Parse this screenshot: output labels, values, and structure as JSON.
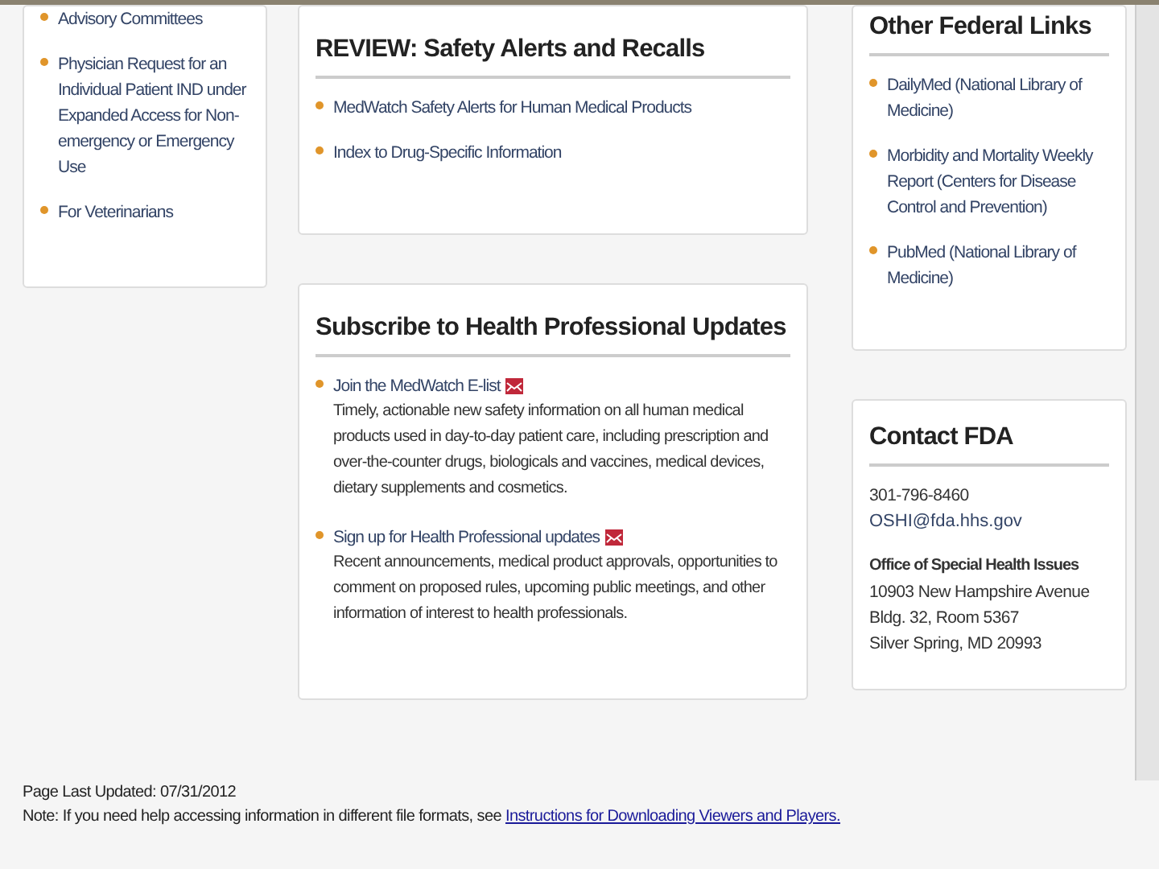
{
  "left_links": [
    "Advisory Committees",
    "Physician Request for an Individual Patient IND under Expanded Access for Non-emergency or Emergency Use",
    "For Veterinarians"
  ],
  "review": {
    "title": "REVIEW: Safety Alerts and Recalls",
    "links": [
      "MedWatch Safety Alerts for Human Medical Products",
      "Index to Drug-Specific Information"
    ]
  },
  "subscribe": {
    "title": "Subscribe to Health Professional Updates",
    "items": [
      {
        "link": "Join the MedWatch E-list",
        "description": "Timely, actionable new safety information on all human medical products used in day-to-day patient care, including prescription and over-the-counter drugs, biologicals and vaccines, medical devices, dietary supplements and cosmetics."
      },
      {
        "link": "Sign up for Health Professional updates",
        "description": "Recent announcements, medical product approvals, opportunities to comment on proposed rules, upcoming public meetings, and other information of interest to health professionals."
      }
    ]
  },
  "federal": {
    "title": "Other Federal Links",
    "links": [
      "DailyMed (National Library of Medicine)",
      "Morbidity and Mortality Weekly Report (Centers for Disease Control and Prevention)",
      "PubMed (National Library of Medicine)"
    ]
  },
  "contact": {
    "title": "Contact FDA",
    "phone": "301-796-8460",
    "email": "OSHI@fda.hhs.gov",
    "office": "Office of Special Health Issues",
    "address": [
      "10903 New Hampshire Avenue",
      "Bldg. 32, Room 5367",
      "Silver Spring, MD 20993"
    ]
  },
  "footer": {
    "updated": "Page Last Updated: 07/31/2012",
    "note": "Note: If you need help accessing information in different file formats, see",
    "note_link": "Instructions for Downloading Viewers and Players."
  }
}
